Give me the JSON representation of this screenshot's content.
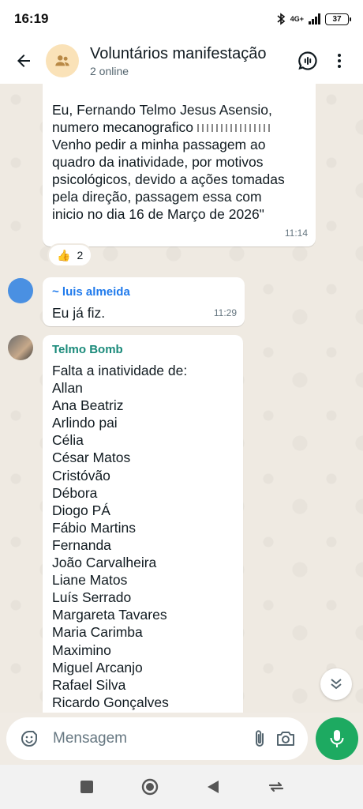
{
  "status_bar": {
    "time": "16:19",
    "network": "4G+",
    "battery": "37"
  },
  "header": {
    "title": "Voluntários manifestação",
    "subtitle": "2 online"
  },
  "messages": [
    {
      "text": "Eu, Fernando Telmo Jesus Asensio,\nnumero mecanografico",
      "text_cont": "Venho pedir a minha passagem ao\nquadro da inatividade, por motivos\npsicológicos, devido a ações tomadas\npela direção, passagem essa com\ninicio no dia 16 de Março de 2026\"",
      "time": "11:14",
      "reaction": {
        "emoji": "👍",
        "count": "2"
      }
    },
    {
      "sender": "~ luis almeida",
      "sender_color": "#1f7aec",
      "text": "Eu já fiz.",
      "time": "11:29"
    },
    {
      "sender": "Telmo Bomb",
      "sender_color": "#1a8a7a",
      "text": "Falta a inatividade de:\nAllan\nAna Beatriz\nArlindo pai\nCélia\nCésar Matos\nCristóvão\nDébora\nDiogo PÁ\nFábio Martins\nFernanda\nJoão Carvalheira\nLiane Matos\nLuís Serrado\nMargareta Tavares\nMaria Carimba\nMaximino\nMiguel Arcanjo\nRafael Silva\nRicardo Gonçalves"
    }
  ],
  "input": {
    "placeholder": "Mensagem"
  },
  "colors": {
    "accent": "#1daa61",
    "chat_bg": "#efeae2"
  }
}
